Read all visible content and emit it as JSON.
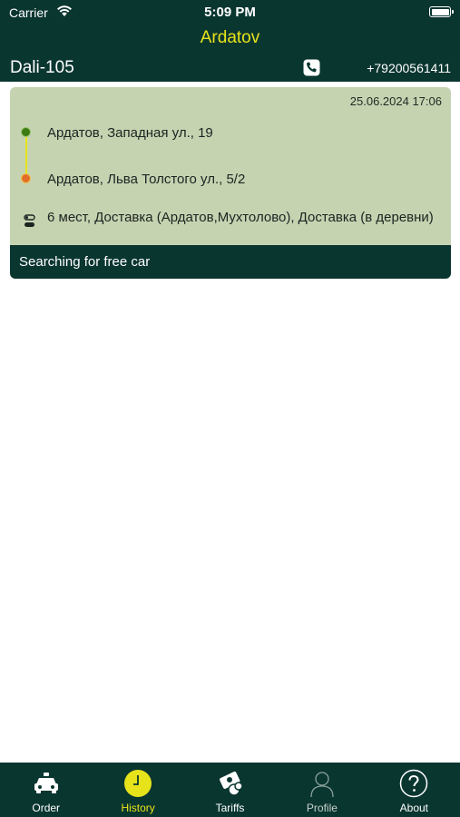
{
  "status_bar": {
    "carrier": "Carrier",
    "time": "5:09 PM"
  },
  "nav": {
    "title": "Ardatov"
  },
  "info": {
    "name": "Dali-105",
    "phone": "+79200561411"
  },
  "order": {
    "date": "25.06.2024 17:06",
    "from": "Ардатов, Западная ул., 19",
    "to": "Ардатов, Льва Толстого ул., 5/2",
    "details": "6 мест, Доставка (Ардатов,Мухтолово), Доставка (в деревни)",
    "status": "Searching for free car"
  },
  "tabs": [
    {
      "label": "Order",
      "icon": "taxi-icon"
    },
    {
      "label": "History",
      "icon": "clock-icon",
      "active": true
    },
    {
      "label": "Tariffs",
      "icon": "tariff-icon"
    },
    {
      "label": "Profile",
      "icon": "person-icon"
    },
    {
      "label": "About",
      "icon": "question-icon"
    }
  ],
  "colors": {
    "bar_background": "#0a3630",
    "accent_yellow": "#e7e31b",
    "card_background": "#c5d3b1",
    "route_start": "#3c7a12",
    "route_end": "#e26f28"
  }
}
